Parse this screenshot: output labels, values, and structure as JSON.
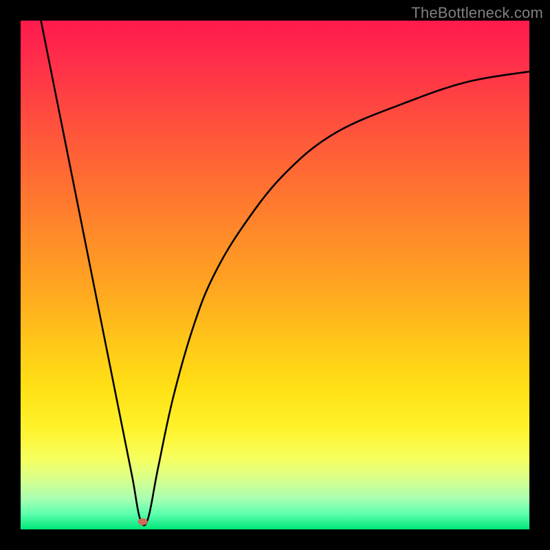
{
  "watermark": "TheBottleneck.com",
  "chart_data": {
    "type": "line",
    "title": "",
    "xlabel": "",
    "ylabel": "",
    "xlim": [
      0,
      100
    ],
    "ylim": [
      0,
      100
    ],
    "grid": false,
    "series": [
      {
        "name": "curve",
        "stroke": "#000000",
        "x": [
          4,
          6,
          8,
          10,
          12,
          14,
          16,
          18,
          20,
          22,
          23.5,
          25,
          27,
          30,
          34,
          38,
          44,
          52,
          62,
          76,
          88,
          100
        ],
        "y": [
          100,
          90,
          80,
          70,
          60,
          50,
          40,
          30,
          20,
          10,
          2,
          2,
          12,
          26,
          40,
          50,
          60,
          70,
          78,
          84,
          88,
          90
        ]
      }
    ],
    "marker": {
      "name": "min-point",
      "x": 24,
      "y": 1.5,
      "color": "#d46a5a"
    },
    "background_gradient": {
      "direction": "top-to-bottom",
      "stops": [
        {
          "pos": 0.0,
          "color": "#ff1a4d"
        },
        {
          "pos": 0.3,
          "color": "#ff6a33"
        },
        {
          "pos": 0.6,
          "color": "#ffc918"
        },
        {
          "pos": 0.85,
          "color": "#f7ff5e"
        },
        {
          "pos": 1.0,
          "color": "#00e77a"
        }
      ]
    }
  }
}
